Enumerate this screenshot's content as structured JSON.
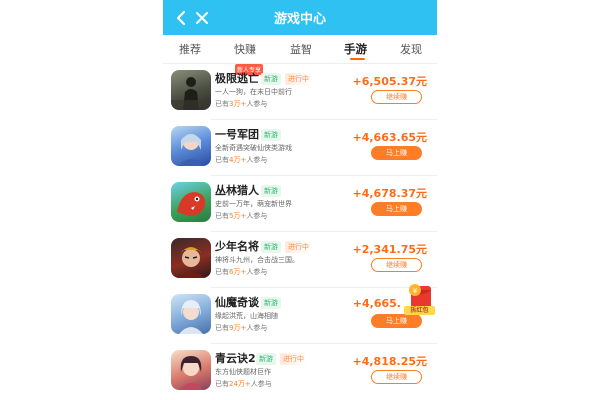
{
  "header": {
    "title": "游戏中心"
  },
  "tabs": [
    {
      "label": "推荐"
    },
    {
      "label": "快赚",
      "badge": "新人专享"
    },
    {
      "label": "益智"
    },
    {
      "label": "手游"
    },
    {
      "label": "发现"
    }
  ],
  "games": [
    {
      "name": "极限逃亡",
      "tags": [
        "新游",
        "进行中"
      ],
      "desc": "一人一狗，在末日中前行",
      "players_prefix": "已有",
      "players_count": "3万+",
      "players_suffix": "人参与",
      "amount": "+6,505.37元",
      "button": "继续赚"
    },
    {
      "name": "一号军团",
      "tags": [
        "新游"
      ],
      "desc": "全新奇遇突破仙侠类游戏",
      "players_prefix": "已有",
      "players_count": "4万+",
      "players_suffix": "人参与",
      "amount": "+4,663.65元",
      "button": "马上赚"
    },
    {
      "name": "丛林猎人",
      "tags": [
        "新游"
      ],
      "desc": "史前一万年，萌宠新世界",
      "players_prefix": "已有",
      "players_count": "5万+",
      "players_suffix": "人参与",
      "amount": "+4,678.37元",
      "button": "马上赚"
    },
    {
      "name": "少年名将",
      "tags": [
        "新游",
        "进行中"
      ],
      "desc": "神将斗九州，合击战三国。",
      "players_prefix": "已有",
      "players_count": "6万+",
      "players_suffix": "人参与",
      "amount": "+2,341.75元",
      "button": "继续赚"
    },
    {
      "name": "仙魔奇谈",
      "tags": [
        "新游"
      ],
      "desc": "缘起洪荒，山海相随",
      "players_prefix": "已有",
      "players_count": "9万+",
      "players_suffix": "人参与",
      "amount": "+4,665.",
      "button": "马上赚"
    },
    {
      "name": "青云诀2",
      "tags": [
        "新游",
        "进行中"
      ],
      "desc": "东方仙侠题材巨作",
      "players_prefix": "已有",
      "players_count": "24万+",
      "players_suffix": "人参与",
      "amount": "+4,818.25元",
      "button": "继续赚"
    }
  ],
  "red_packet": {
    "label": "拆红包"
  },
  "colors": {
    "header": "#2ec1f2",
    "accent": "#ff6b17",
    "new_tag": "#31b96f"
  }
}
